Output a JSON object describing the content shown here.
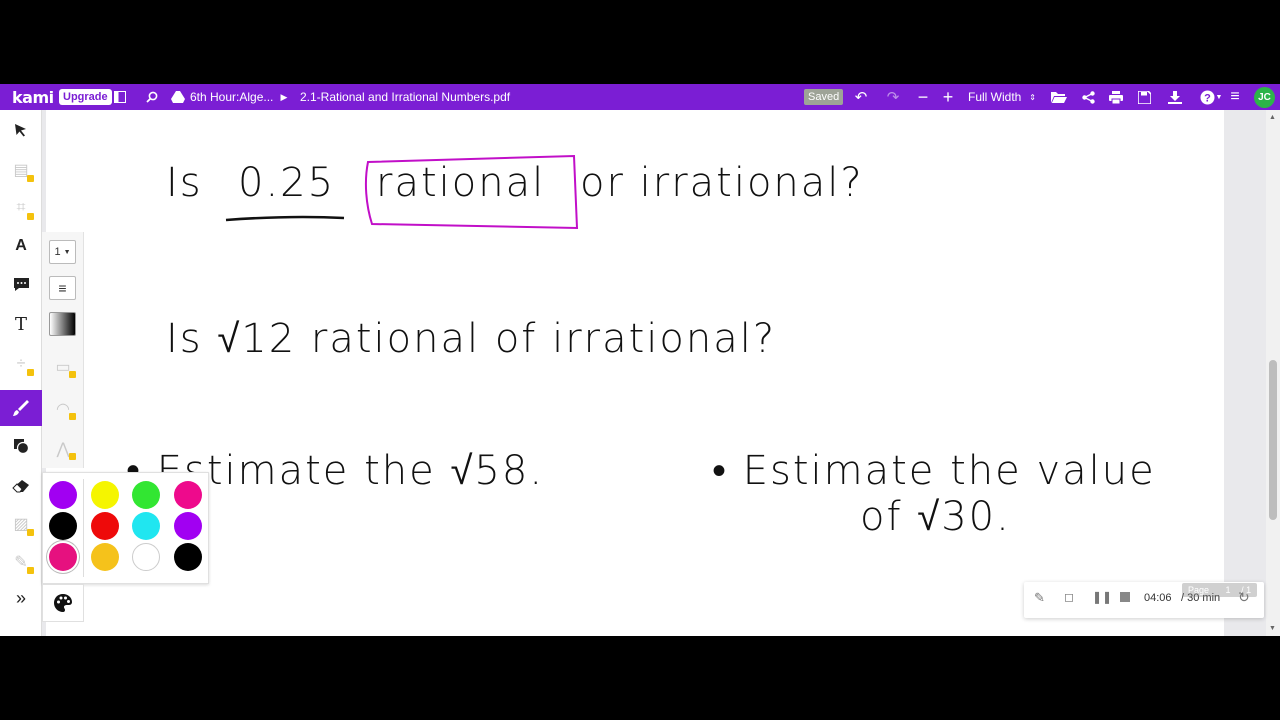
{
  "topbar": {
    "logo": "kami",
    "upgrade_label": "Upgrade",
    "breadcrumb_folder": "6th Hour:Alge...",
    "breadcrumb_file": "2.1-Rational and Irrational Numbers.pdf",
    "saved_label": "Saved",
    "zoom_value": "Full Width",
    "avatar_initials": "JC",
    "accent_color": "#7b1ed4"
  },
  "document": {
    "line1_prefix": "Is",
    "line1_number": "0.25",
    "line1_boxed": "rational",
    "line1_suffix": "or irrational?",
    "line2": "Is √12  rational of irrational?",
    "bullet1": "• Estimate the √58.",
    "bullet2_line1": "• Estimate the value",
    "bullet2_line2": "of √30."
  },
  "subtools": {
    "stroke_width": "1"
  },
  "palette": {
    "colors": [
      "#a100f2",
      "#f5f500",
      "#32e632",
      "#ee0a8c",
      "#000000",
      "#ee0a0a",
      "#20e6f0",
      "#a100f2",
      "#e6117f",
      "#f5c21b",
      "#ffffff",
      "#000000"
    ],
    "selected_index": 8
  },
  "timer": {
    "elapsed": "04:06",
    "total": "/ 30 min",
    "page_label": "Page",
    "page_current": "1",
    "page_total": "/ 1"
  }
}
